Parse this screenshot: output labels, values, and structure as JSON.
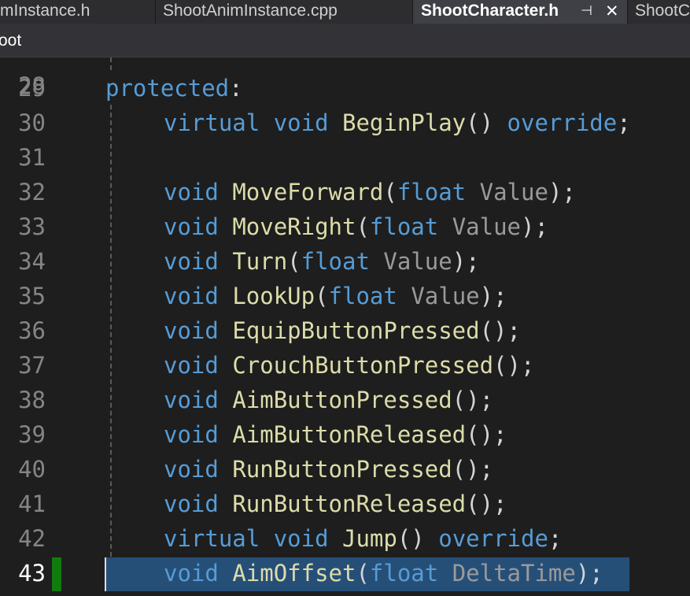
{
  "tabs": [
    {
      "label": "mInstance.h",
      "active": false
    },
    {
      "label": "ShootAnimInstance.cpp",
      "active": false
    },
    {
      "label": "ShootCharacter.h",
      "active": true
    },
    {
      "label": "ShootC",
      "active": false
    }
  ],
  "tab_controls": {
    "pin_glyph": "⊣",
    "close_glyph": "✕"
  },
  "navbar": {
    "project": "oot"
  },
  "editor": {
    "partial_top_line": "28",
    "current_line": "43",
    "lines": [
      {
        "num": "29",
        "indent": 0,
        "tokens": [
          {
            "t": "protected",
            "c": "kw"
          },
          {
            "t": ":",
            "c": "pn"
          }
        ]
      },
      {
        "num": "30",
        "indent": 1,
        "tokens": [
          {
            "t": "virtual",
            "c": "kw"
          },
          {
            "t": " ",
            "c": "pn"
          },
          {
            "t": "void",
            "c": "kw"
          },
          {
            "t": " ",
            "c": "pn"
          },
          {
            "t": "BeginPlay",
            "c": "fn"
          },
          {
            "t": "() ",
            "c": "pn"
          },
          {
            "t": "override",
            "c": "kw"
          },
          {
            "t": ";",
            "c": "pn"
          }
        ]
      },
      {
        "num": "31",
        "indent": 1,
        "tokens": []
      },
      {
        "num": "32",
        "indent": 1,
        "tokens": [
          {
            "t": "void",
            "c": "kw"
          },
          {
            "t": " ",
            "c": "pn"
          },
          {
            "t": "MoveForward",
            "c": "fn"
          },
          {
            "t": "(",
            "c": "pn"
          },
          {
            "t": "float",
            "c": "kw"
          },
          {
            "t": " ",
            "c": "pn"
          },
          {
            "t": "Value",
            "c": "pm"
          },
          {
            "t": ");",
            "c": "pn"
          }
        ]
      },
      {
        "num": "33",
        "indent": 1,
        "tokens": [
          {
            "t": "void",
            "c": "kw"
          },
          {
            "t": " ",
            "c": "pn"
          },
          {
            "t": "MoveRight",
            "c": "fn"
          },
          {
            "t": "(",
            "c": "pn"
          },
          {
            "t": "float",
            "c": "kw"
          },
          {
            "t": " ",
            "c": "pn"
          },
          {
            "t": "Value",
            "c": "pm"
          },
          {
            "t": ");",
            "c": "pn"
          }
        ]
      },
      {
        "num": "34",
        "indent": 1,
        "tokens": [
          {
            "t": "void",
            "c": "kw"
          },
          {
            "t": " ",
            "c": "pn"
          },
          {
            "t": "Turn",
            "c": "fn"
          },
          {
            "t": "(",
            "c": "pn"
          },
          {
            "t": "float",
            "c": "kw"
          },
          {
            "t": " ",
            "c": "pn"
          },
          {
            "t": "Value",
            "c": "pm"
          },
          {
            "t": ");",
            "c": "pn"
          }
        ]
      },
      {
        "num": "35",
        "indent": 1,
        "tokens": [
          {
            "t": "void",
            "c": "kw"
          },
          {
            "t": " ",
            "c": "pn"
          },
          {
            "t": "LookUp",
            "c": "fn"
          },
          {
            "t": "(",
            "c": "pn"
          },
          {
            "t": "float",
            "c": "kw"
          },
          {
            "t": " ",
            "c": "pn"
          },
          {
            "t": "Value",
            "c": "pm"
          },
          {
            "t": ");",
            "c": "pn"
          }
        ]
      },
      {
        "num": "36",
        "indent": 1,
        "tokens": [
          {
            "t": "void",
            "c": "kw"
          },
          {
            "t": " ",
            "c": "pn"
          },
          {
            "t": "EquipButtonPressed",
            "c": "fn"
          },
          {
            "t": "();",
            "c": "pn"
          }
        ]
      },
      {
        "num": "37",
        "indent": 1,
        "tokens": [
          {
            "t": "void",
            "c": "kw"
          },
          {
            "t": " ",
            "c": "pn"
          },
          {
            "t": "CrouchButtonPressed",
            "c": "fn"
          },
          {
            "t": "();",
            "c": "pn"
          }
        ]
      },
      {
        "num": "38",
        "indent": 1,
        "tokens": [
          {
            "t": "void",
            "c": "kw"
          },
          {
            "t": " ",
            "c": "pn"
          },
          {
            "t": "AimButtonPressed",
            "c": "fn"
          },
          {
            "t": "();",
            "c": "pn"
          }
        ]
      },
      {
        "num": "39",
        "indent": 1,
        "tokens": [
          {
            "t": "void",
            "c": "kw"
          },
          {
            "t": " ",
            "c": "pn"
          },
          {
            "t": "AimButtonReleased",
            "c": "fn"
          },
          {
            "t": "();",
            "c": "pn"
          }
        ]
      },
      {
        "num": "40",
        "indent": 1,
        "tokens": [
          {
            "t": "void",
            "c": "kw"
          },
          {
            "t": " ",
            "c": "pn"
          },
          {
            "t": "RunButtonPressed",
            "c": "fn"
          },
          {
            "t": "();",
            "c": "pn"
          }
        ]
      },
      {
        "num": "41",
        "indent": 1,
        "tokens": [
          {
            "t": "void",
            "c": "kw"
          },
          {
            "t": " ",
            "c": "pn"
          },
          {
            "t": "RunButtonReleased",
            "c": "fn"
          },
          {
            "t": "();",
            "c": "pn"
          }
        ]
      },
      {
        "num": "42",
        "indent": 1,
        "tokens": [
          {
            "t": "virtual",
            "c": "kw"
          },
          {
            "t": " ",
            "c": "pn"
          },
          {
            "t": "void",
            "c": "kw"
          },
          {
            "t": " ",
            "c": "pn"
          },
          {
            "t": "Jump",
            "c": "fn"
          },
          {
            "t": "() ",
            "c": "pn"
          },
          {
            "t": "override",
            "c": "kw"
          },
          {
            "t": ";",
            "c": "pn"
          }
        ]
      },
      {
        "num": "43",
        "indent": 1,
        "tokens": [
          {
            "t": "void",
            "c": "kw"
          },
          {
            "t": " ",
            "c": "pn"
          },
          {
            "t": "AimOffset",
            "c": "fn"
          },
          {
            "t": "(",
            "c": "pn"
          },
          {
            "t": "float",
            "c": "kw"
          },
          {
            "t": " ",
            "c": "pn"
          },
          {
            "t": "DeltaTime",
            "c": "pm"
          },
          {
            "t": ");",
            "c": "pn"
          }
        ]
      }
    ]
  },
  "colors": {
    "keyword": "#569cd6",
    "function": "#dcdcaa",
    "punctuation": "#d4d4d4",
    "parameter": "#9a9a9a",
    "selection": "#264f78",
    "change_marker": "#107c10"
  }
}
